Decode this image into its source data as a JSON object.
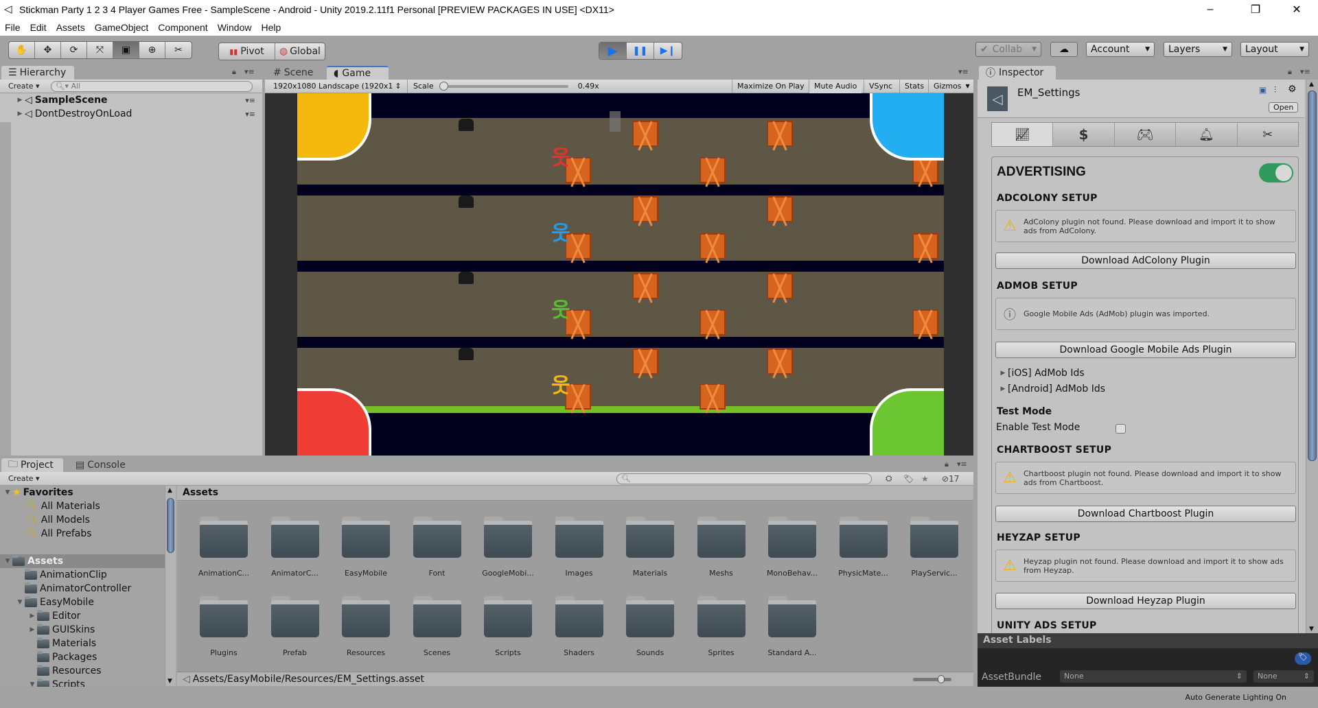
{
  "window": {
    "title": "Stickman Party 1 2 3 4 Player Games Free - SampleScene - Android - Unity 2019.2.11f1 Personal [PREVIEW PACKAGES IN USE] <DX11>",
    "controls": {
      "minimize": "–",
      "maximize": "❐",
      "close": "✕"
    }
  },
  "menu": [
    "File",
    "Edit",
    "Assets",
    "GameObject",
    "Component",
    "Window",
    "Help"
  ],
  "toolbar": {
    "tools": [
      {
        "name": "hand-tool",
        "glyph": "✋"
      },
      {
        "name": "move-tool",
        "glyph": "✥"
      },
      {
        "name": "rotate-tool",
        "glyph": "⟳"
      },
      {
        "name": "scale-tool",
        "glyph": "⤧"
      },
      {
        "name": "rect-tool",
        "glyph": "▣"
      },
      {
        "name": "transform-tool",
        "glyph": "⊕"
      },
      {
        "name": "custom-tool",
        "glyph": "✂"
      }
    ],
    "active_tool": "rect-tool",
    "pivot": "Pivot",
    "global": "Global",
    "play": {
      "play": "▶",
      "pause": "❚❚",
      "step": "▶❙",
      "playing": true,
      "accent": "#1a73e8"
    },
    "collab": "Collab",
    "account": "Account",
    "layers": "Layers",
    "layout": "Layout"
  },
  "hierarchy": {
    "tab": "Hierarchy",
    "create": "Create",
    "search_placeholder": "All",
    "items": [
      {
        "label": "SampleScene",
        "bold": true
      },
      {
        "label": "DontDestroyOnLoad",
        "bold": false
      }
    ]
  },
  "scene_tabs": {
    "scene": "Scene",
    "game": "Game"
  },
  "game_toolbar": {
    "resolution": "1920x1080 Landscape (1920x1",
    "scale_label": "Scale",
    "scale_value": "0.49x",
    "scale_fraction": 0.0,
    "maximize": "Maximize On Play",
    "mute": "Mute Audio",
    "vsync": "VSync",
    "stats": "Stats",
    "gizmos": "Gizmos"
  },
  "game": {
    "corner_colors": {
      "top_left": "#f4b90c",
      "top_right": "#22aef0",
      "bottom_left": "#ef3d35",
      "bottom_right": "#6cc631"
    },
    "players": [
      {
        "color": "#e8302a",
        "lane": 1
      },
      {
        "color": "#1e9df0",
        "lane": 2
      },
      {
        "color": "#55c12a",
        "lane": 3
      },
      {
        "color": "#f5b90a",
        "lane": 4
      }
    ]
  },
  "inspector": {
    "tab": "Inspector",
    "asset_name": "EM_Settings",
    "open_button": "Open",
    "module_tabs": [
      "analytics-icon",
      "dollar-icon",
      "gamepad-icon",
      "bell-icon",
      "tools-icon"
    ],
    "section_title": "ADVERTISING",
    "advertising_enabled": true,
    "adcolony": {
      "title": "ADCOLONY SETUP",
      "message": "AdColony plugin not found. Please download and import it to show ads from AdColony.",
      "button": "Download AdColony Plugin"
    },
    "admob": {
      "title": "ADMOB SETUP",
      "message": "Google Mobile Ads (AdMob) plugin was imported.",
      "button": "Download Google Mobile Ads Plugin",
      "ios_ids": "[iOS] AdMob Ids",
      "android_ids": "[Android] AdMob Ids",
      "test_mode_title": "Test Mode",
      "enable_test_mode": "Enable Test Mode",
      "test_mode_checked": false
    },
    "chartboost": {
      "title": "CHARTBOOST SETUP",
      "message": "Chartboost plugin not found. Please download and import it to show ads from Chartboost.",
      "button": "Download Chartboost Plugin"
    },
    "heyzap": {
      "title": "HEYZAP SETUP",
      "message": "Heyzap plugin not found. Please download and import it to show ads from Heyzap.",
      "button": "Download Heyzap Plugin"
    },
    "unity_ads": {
      "title": "UNITY ADS SETUP"
    },
    "asset_labels": "Asset Labels",
    "asset_bundle_label": "AssetBundle",
    "asset_bundle_value": "None",
    "asset_bundle_variant": "None"
  },
  "project": {
    "tabs": {
      "project": "Project",
      "console": "Console"
    },
    "create": "Create",
    "hidden_count": "17",
    "favorites": {
      "label": "Favorites",
      "items": [
        "All Materials",
        "All Models",
        "All Prefabs"
      ]
    },
    "tree": [
      {
        "label": "Assets",
        "depth": 0,
        "arrow": "▼",
        "selected": true
      },
      {
        "label": "AnimationClip",
        "depth": 1,
        "arrow": ""
      },
      {
        "label": "AnimatorController",
        "depth": 1,
        "arrow": ""
      },
      {
        "label": "EasyMobile",
        "depth": 1,
        "arrow": "▼"
      },
      {
        "label": "Editor",
        "depth": 2,
        "arrow": "▶"
      },
      {
        "label": "GUISkins",
        "depth": 2,
        "arrow": "▶"
      },
      {
        "label": "Materials",
        "depth": 2,
        "arrow": ""
      },
      {
        "label": "Packages",
        "depth": 2,
        "arrow": ""
      },
      {
        "label": "Resources",
        "depth": 2,
        "arrow": ""
      },
      {
        "label": "Scripts",
        "depth": 2,
        "arrow": "▼"
      }
    ],
    "breadcrumb": "Assets",
    "folders": [
      "AnimationC...",
      "AnimatorC...",
      "EasyMobile",
      "Font",
      "GoogleMobi...",
      "Images",
      "Materials",
      "Meshs",
      "MonoBehav...",
      "PhysicMate...",
      "PlayServic...",
      "Plugins",
      "Prefab",
      "Resources",
      "Scenes",
      "Scripts",
      "Shaders",
      "Sounds",
      "Sprites",
      "Standard A..."
    ],
    "selected_path": "Assets/EasyMobile/Resources/EM_Settings.asset"
  },
  "status": {
    "lighting": "Auto Generate Lighting On"
  }
}
